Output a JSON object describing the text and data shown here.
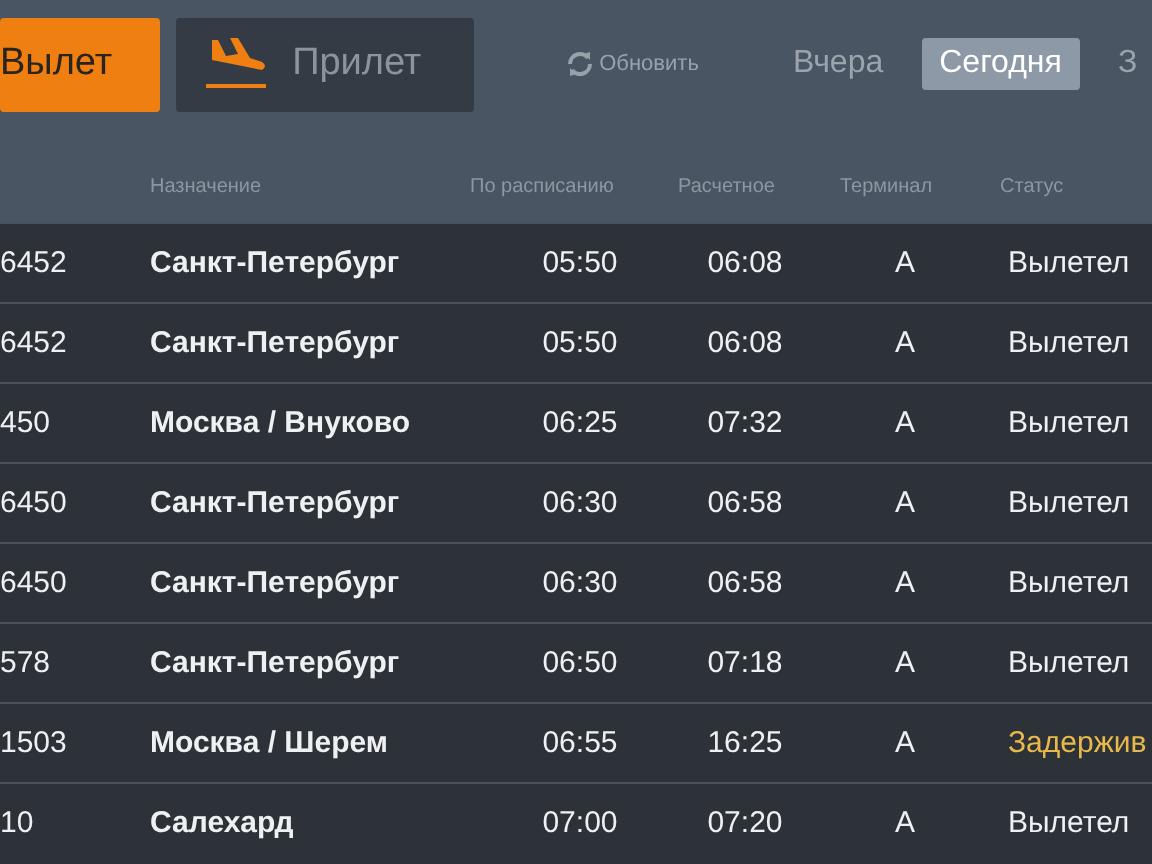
{
  "direction_tabs": [
    {
      "label": "Вылет",
      "selected": true,
      "kind": "departure"
    },
    {
      "label": "Прилет",
      "selected": false,
      "kind": "arrival"
    }
  ],
  "refresh": {
    "label": "Обновить"
  },
  "days": [
    {
      "label": "Вчера",
      "selected": false
    },
    {
      "label": "Сегодня",
      "selected": true
    },
    {
      "label": "З",
      "selected": false
    }
  ],
  "table": {
    "columns": [
      "Назначение",
      "По расписанию",
      "Расчетное",
      "Терминал",
      "Статус"
    ],
    "rows": [
      {
        "flight": "6452",
        "destination": "Санкт-Петербург",
        "scheduled": "05:50",
        "estimated": "06:08",
        "terminal": "A",
        "status": "Вылетел",
        "kind": "departed"
      },
      {
        "flight": "6452",
        "destination": "Санкт-Петербург",
        "scheduled": "05:50",
        "estimated": "06:08",
        "terminal": "A",
        "status": "Вылетел",
        "kind": "departed"
      },
      {
        "flight": "450",
        "destination": "Москва / Внуково",
        "scheduled": "06:25",
        "estimated": "07:32",
        "terminal": "A",
        "status": "Вылетел",
        "kind": "departed"
      },
      {
        "flight": "6450",
        "destination": "Санкт-Петербург",
        "scheduled": "06:30",
        "estimated": "06:58",
        "terminal": "A",
        "status": "Вылетел",
        "kind": "departed"
      },
      {
        "flight": "6450",
        "destination": "Санкт-Петербург",
        "scheduled": "06:30",
        "estimated": "06:58",
        "terminal": "A",
        "status": "Вылетел",
        "kind": "departed"
      },
      {
        "flight": "578",
        "destination": "Санкт-Петербург",
        "scheduled": "06:50",
        "estimated": "07:18",
        "terminal": "A",
        "status": "Вылетел",
        "kind": "departed"
      },
      {
        "flight": "1503",
        "destination": "Москва / Шерем",
        "scheduled": "06:55",
        "estimated": "16:25",
        "terminal": "A",
        "status": "Задержив",
        "kind": "delayed"
      },
      {
        "flight": "10",
        "destination": "Салехард",
        "scheduled": "07:00",
        "estimated": "07:20",
        "terminal": "A",
        "status": "Вылетел",
        "kind": "departed"
      }
    ]
  }
}
